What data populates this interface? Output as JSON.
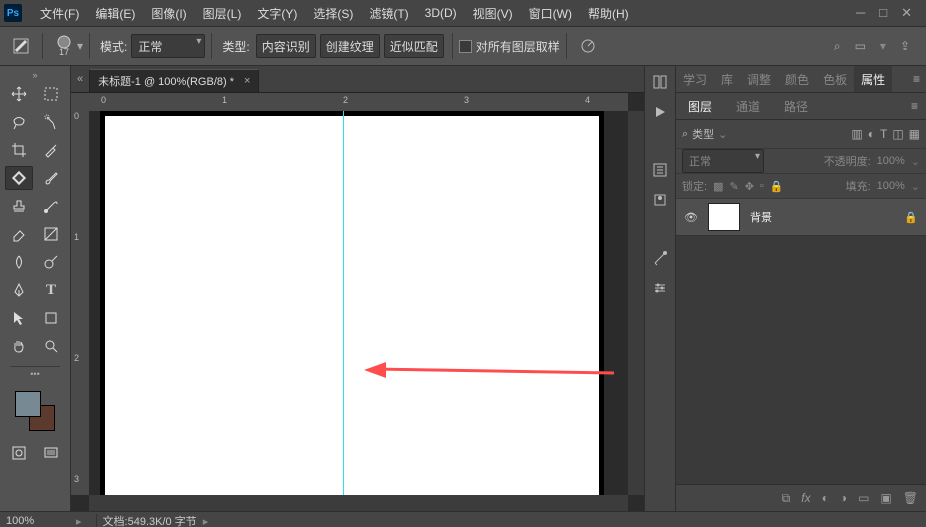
{
  "app": {
    "logo": "Ps"
  },
  "menu": [
    "文件(F)",
    "编辑(E)",
    "图像(I)",
    "图层(L)",
    "文字(Y)",
    "选择(S)",
    "滤镜(T)",
    "3D(D)",
    "视图(V)",
    "窗口(W)",
    "帮助(H)"
  ],
  "optbar": {
    "brush_size": "17",
    "mode_label": "模式:",
    "mode_value": "正常",
    "type_label": "类型:",
    "b1": "内容识别",
    "b2": "创建纹理",
    "b3": "近似匹配",
    "chk_label": "对所有图层取样"
  },
  "doc": {
    "tab": "未标题-1 @ 100%(RGB/8) *"
  },
  "ruler_h": [
    "0",
    "1",
    "2",
    "3",
    "4"
  ],
  "ruler_v": [
    "0",
    "1",
    "2",
    "3"
  ],
  "panels": {
    "top": [
      "学习",
      "库",
      "调整",
      "颜色",
      "色板",
      "属性"
    ],
    "layer_tabs": [
      "图层",
      "通道",
      "路径"
    ],
    "kind_label": "类型",
    "blend": "正常",
    "opacity_label": "不透明度:",
    "opacity_val": "100%",
    "lock_label": "锁定:",
    "fill_label": "填充:",
    "fill_val": "100%",
    "layer_name": "背景",
    "search_icon": "⌕"
  },
  "status": {
    "zoom": "100%",
    "doc": "文档:549.3K/0 字节"
  },
  "icons": {
    "search": "⌕",
    "arrange": "▭",
    "share": "⇪",
    "target": "◎",
    "link": "⧉",
    "fx": "fx",
    "mask": "◐",
    "adjust": "◑",
    "folder": "▭",
    "new": "▣",
    "trash": "🗑"
  }
}
